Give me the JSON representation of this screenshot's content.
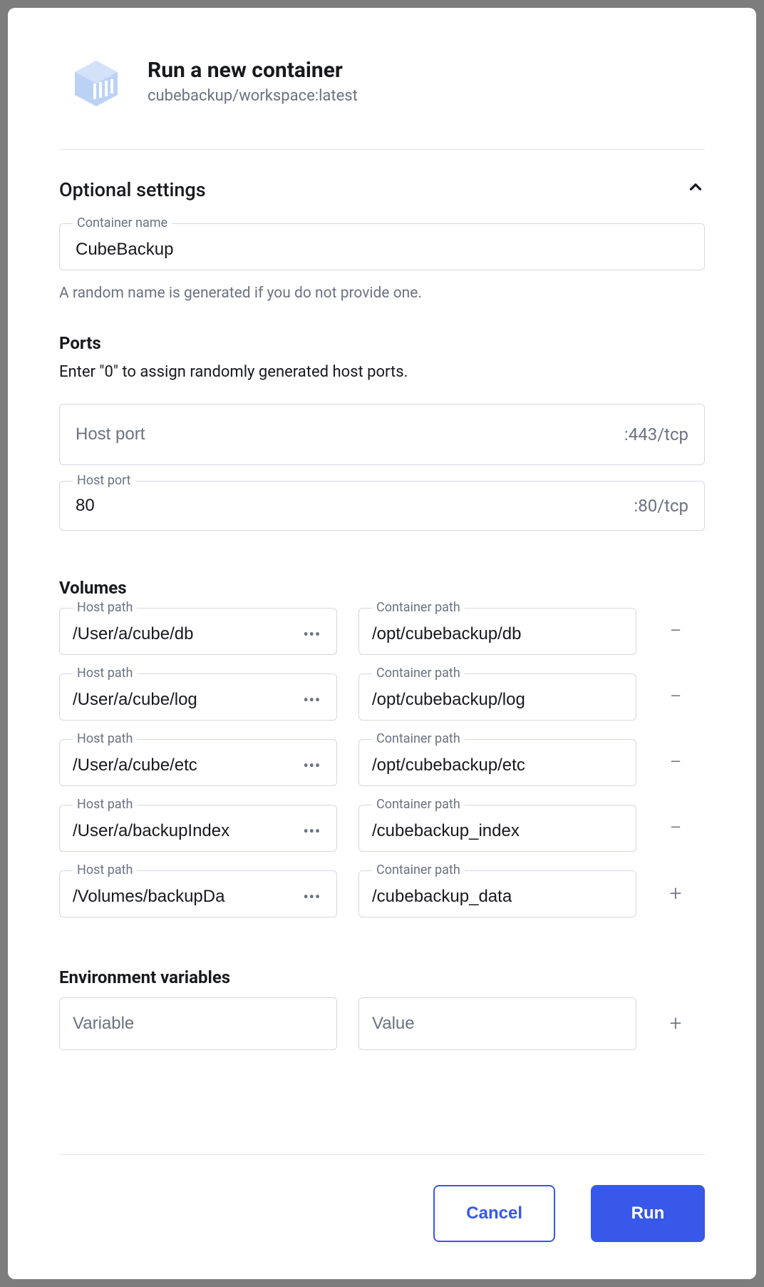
{
  "header": {
    "title": "Run a new container",
    "subtitle": "cubebackup/workspace:latest"
  },
  "optional": {
    "title": "Optional settings",
    "containerName": {
      "label": "Container name",
      "value": "CubeBackup",
      "help": "A random name is generated if you do not provide one."
    }
  },
  "ports": {
    "title": "Ports",
    "help": "Enter \"0\" to assign randomly generated host ports.",
    "hostPortLabel": "Host port",
    "hostPortPlaceholder": "Host port",
    "rows": [
      {
        "value": "",
        "suffix": ":443/tcp",
        "showLabel": false
      },
      {
        "value": "80",
        "suffix": ":80/tcp",
        "showLabel": true
      }
    ]
  },
  "volumes": {
    "title": "Volumes",
    "hostPathLabel": "Host path",
    "containerPathLabel": "Container path",
    "rows": [
      {
        "host": "/User/a/cube/db",
        "container": "/opt/cubebackup/db",
        "action": "remove"
      },
      {
        "host": "/User/a/cube/log",
        "container": "/opt/cubebackup/log",
        "action": "remove"
      },
      {
        "host": "/User/a/cube/etc",
        "container": "/opt/cubebackup/etc",
        "action": "remove"
      },
      {
        "host": "/User/a/backupIndex",
        "container": "/cubebackup_index",
        "action": "remove"
      },
      {
        "host": "/Volumes/backupDa",
        "container": "/cubebackup_data",
        "action": "add"
      }
    ]
  },
  "env": {
    "title": "Environment variables",
    "variablePlaceholder": "Variable",
    "valuePlaceholder": "Value"
  },
  "footer": {
    "cancel": "Cancel",
    "run": "Run"
  }
}
